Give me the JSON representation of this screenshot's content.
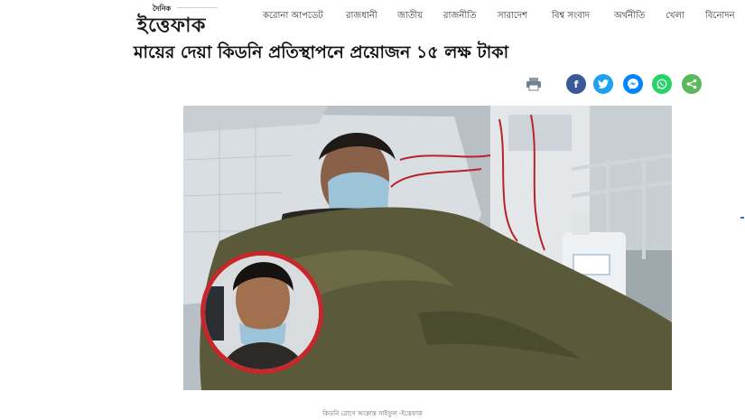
{
  "header": {
    "logo_small": "দৈনিক",
    "logo_big": "ইত্তেফাক",
    "nav": [
      "করোনা আপডেট",
      "রাজধানী",
      "জাতীয়",
      "রাজনীতি",
      "সারাদেশ",
      "বিশ্ব সংবাদ",
      "অর্থনীতি",
      "খেলা",
      "বিনোদন"
    ]
  },
  "article": {
    "headline": "মায়ের দেয়া কিডনি প্রতিস্থাপনে প্রয়োজন ১৫ লক্ষ টাকা",
    "caption": "কিডনি রোগে আক্রান্ত সাইফুল -ইত্তেফাক"
  },
  "share": {
    "icons": [
      "print-icon",
      "facebook-icon",
      "twitter-icon",
      "messenger-icon",
      "whatsapp-icon",
      "share-icon"
    ],
    "colors": {
      "facebook": "#3b5998",
      "twitter": "#1da1f2",
      "messenger": "#0084ff",
      "whatsapp": "#25d366",
      "share": "#5cb85c"
    }
  }
}
